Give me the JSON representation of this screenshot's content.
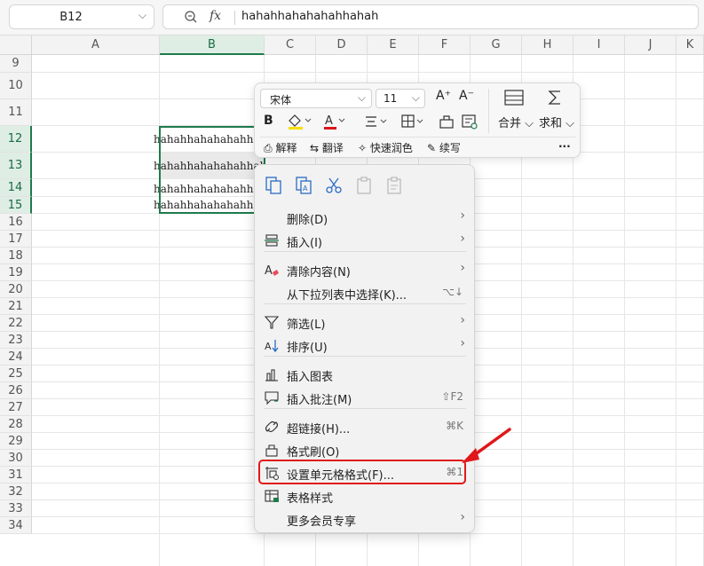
{
  "formula_bar": {
    "name_box": "B12",
    "fx_label": "fx",
    "value": "hahahhahahahahhahah"
  },
  "columns": [
    "A",
    "B",
    "C",
    "D",
    "E",
    "F",
    "G",
    "H",
    "I",
    "J",
    "K"
  ],
  "rows": [
    "9",
    "10",
    "11",
    "12",
    "13",
    "14",
    "15",
    "16",
    "17",
    "18",
    "19",
    "20",
    "21",
    "22",
    "23",
    "24",
    "25",
    "26",
    "27",
    "28",
    "29",
    "30",
    "31",
    "32",
    "33",
    "34"
  ],
  "cells": {
    "b12": "hahahhahahahahhahah",
    "b13": "hahahhahahahahhahah",
    "b14": "hahahhahahahahhahah",
    "b15": "hahahhahahahahhahah"
  },
  "mini_toolbar": {
    "font_name": "宋体",
    "font_size": "11",
    "bold": "B",
    "increase_font": "A⁺",
    "decrease_font": "A⁻",
    "merge_label": "合并",
    "sum_label": "求和",
    "explain_label": "解释",
    "translate_label": "翻译",
    "quick_color_label": "快速润色",
    "continue_label": "续写",
    "more": "···"
  },
  "context_menu": {
    "items": [
      {
        "label": "删除(D)",
        "shortcut": "",
        "submenu": true
      },
      {
        "label": "插入(I)",
        "shortcut": "",
        "submenu": true
      },
      {
        "label": "清除内容(N)",
        "shortcut": "",
        "submenu": true
      },
      {
        "label": "从下拉列表中选择(K)...",
        "shortcut": "⌥↓",
        "submenu": false
      },
      {
        "label": "筛选(L)",
        "shortcut": "",
        "submenu": true
      },
      {
        "label": "排序(U)",
        "shortcut": "",
        "submenu": true
      },
      {
        "label": "插入图表",
        "shortcut": "",
        "submenu": false
      },
      {
        "label": "插入批注(M)",
        "shortcut": "⇧F2",
        "submenu": false
      },
      {
        "label": "超链接(H)...",
        "shortcut": "⌘K",
        "submenu": false
      },
      {
        "label": "格式刷(O)",
        "shortcut": "",
        "submenu": false
      },
      {
        "label": "设置单元格格式(F)...",
        "shortcut": "⌘1",
        "submenu": false
      },
      {
        "label": "表格样式",
        "shortcut": "",
        "submenu": false
      },
      {
        "label": "更多会员专享",
        "shortcut": "",
        "submenu": true
      }
    ]
  },
  "colors": {
    "accent_green": "#1e7b4c",
    "highlight_red": "#e0181b"
  }
}
